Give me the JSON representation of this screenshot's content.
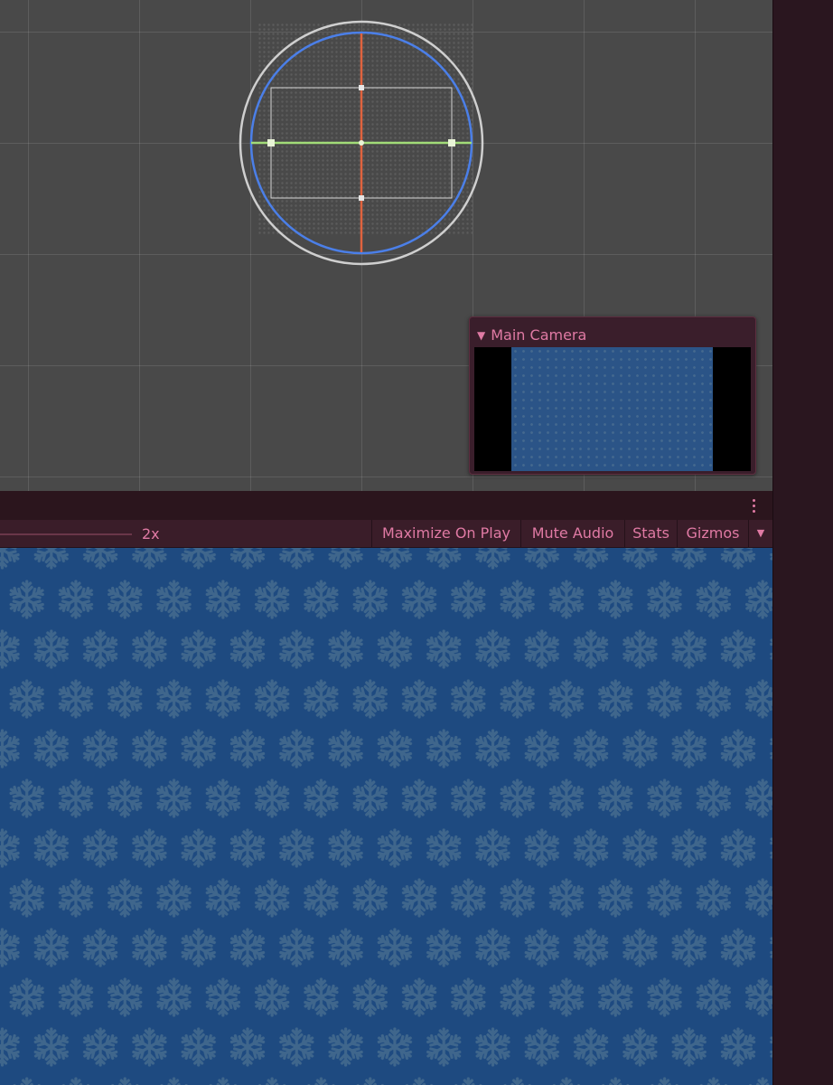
{
  "scene": {
    "camera_preview": {
      "title": "Main Camera"
    }
  },
  "panel": {
    "more_menu_icon": "vertical-ellipsis-icon"
  },
  "game_toolbar": {
    "scale_label": "2x",
    "maximize_on_play": "Maximize On Play",
    "mute_audio": "Mute Audio",
    "stats": "Stats",
    "gizmos": "Gizmos",
    "gizmos_dropdown_icon": "triangle-down-icon"
  },
  "colors": {
    "accent": "#e07aa4",
    "game_background": "#1e4a80",
    "snowflake": "#3f668c",
    "scene_background": "#494949",
    "gizmo_red": "#e0633e",
    "gizmo_green": "#a2dc78",
    "gizmo_blue": "#4b7fe8"
  }
}
